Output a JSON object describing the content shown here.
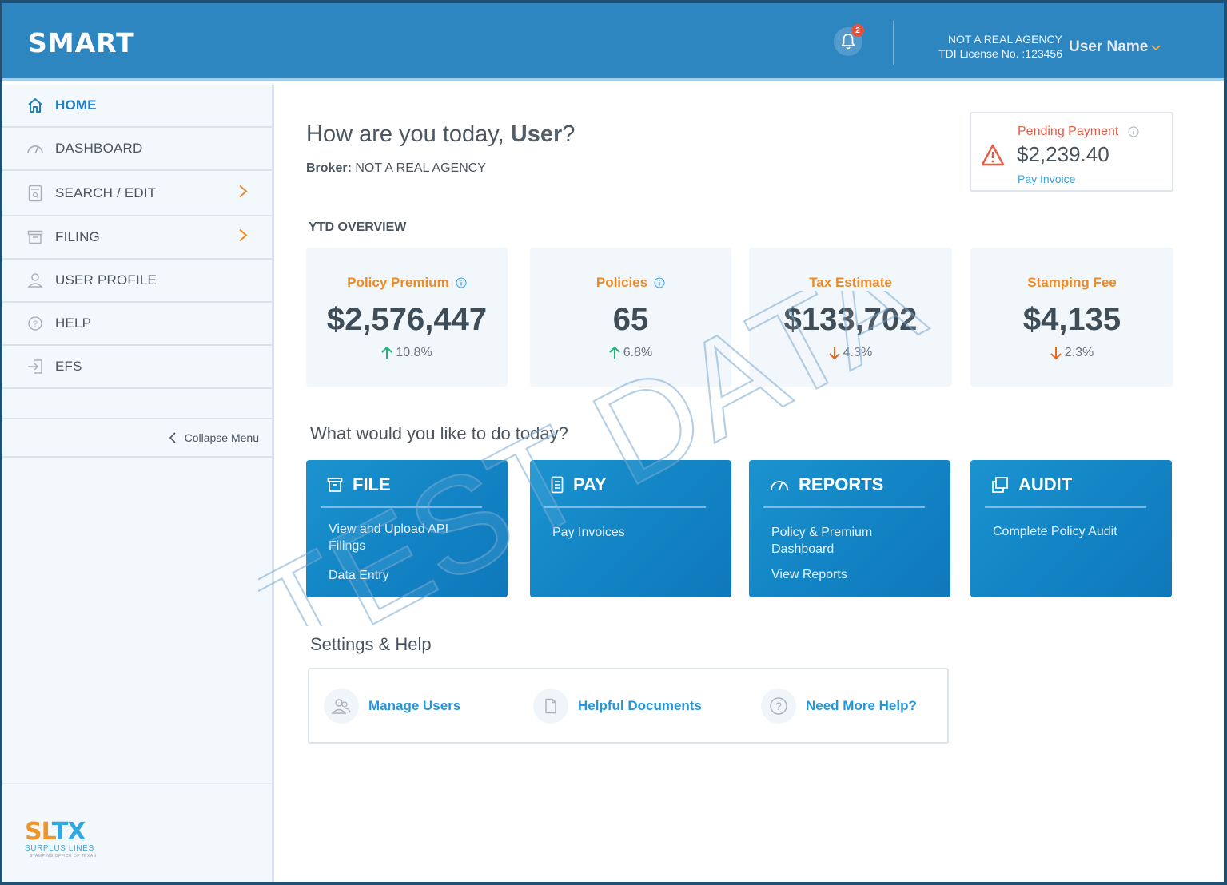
{
  "header": {
    "app_title": "SMART",
    "notification_count": "2",
    "agency_name": "NOT A REAL AGENCY",
    "license": "TDI License No. :123456",
    "user_name": "User Name"
  },
  "sidebar": {
    "items": [
      {
        "label": "HOME",
        "icon": "home-icon",
        "active": true
      },
      {
        "label": "DASHBOARD",
        "icon": "gauge-icon"
      },
      {
        "label": "SEARCH / EDIT",
        "icon": "search-document-icon",
        "has_submenu": true
      },
      {
        "label": "FILING",
        "icon": "archive-box-icon",
        "has_submenu": true
      },
      {
        "label": "USER PROFILE",
        "icon": "user-icon"
      },
      {
        "label": "HELP",
        "icon": "help-circle-icon"
      },
      {
        "label": "EFS",
        "icon": "sign-in-icon"
      }
    ],
    "collapse_label": "Collapse Menu",
    "logo": {
      "main_a": "SL",
      "main_b": "TX",
      "sub": "SURPLUS LINES",
      "tagline": "STAMPING OFFICE OF TEXAS"
    }
  },
  "main": {
    "greeting_prefix": "How are you today,",
    "greeting_name": "User",
    "greeting_suffix": "?",
    "broker_label": "Broker:",
    "broker_value": "NOT A REAL AGENCY",
    "pending": {
      "title": "Pending Payment",
      "amount": "$2,239.40",
      "link": "Pay Invoice"
    },
    "ytd_label": "YTD OVERVIEW",
    "stats": [
      {
        "title": "Policy Premium",
        "value": "$2,576,447",
        "change": "10.8%",
        "direction": "up",
        "info": true
      },
      {
        "title": "Policies",
        "value": "65",
        "change": "6.8%",
        "direction": "up",
        "info": true
      },
      {
        "title": "Tax Estimate",
        "value": "$133,702",
        "change": "4.3%",
        "direction": "down",
        "info": false
      },
      {
        "title": "Stamping Fee",
        "value": "$4,135",
        "change": "2.3%",
        "direction": "down",
        "info": false
      }
    ],
    "actions_label": "What would you like to do today?",
    "actions": [
      {
        "title": "FILE",
        "icon": "archive-box-icon",
        "links": [
          "View and Upload API Filings",
          "Data Entry"
        ]
      },
      {
        "title": "PAY",
        "icon": "invoice-icon",
        "links": [
          "Pay Invoices"
        ]
      },
      {
        "title": "REPORTS",
        "icon": "gauge-icon",
        "links": [
          "Policy & Premium Dashboard",
          "View Reports"
        ]
      },
      {
        "title": "AUDIT",
        "icon": "copy-icon",
        "links": [
          "Complete Policy Audit"
        ]
      }
    ],
    "settings_label": "Settings & Help",
    "settings_links": [
      {
        "label": "Manage Users",
        "icon": "users-icon"
      },
      {
        "label": "Helpful Documents",
        "icon": "document-icon"
      },
      {
        "label": "Need More Help?",
        "icon": "help-circle-icon"
      }
    ],
    "watermark": "TEST DATA"
  },
  "colors": {
    "brand_blue": "#2e86c1",
    "accent_orange": "#eb8a26",
    "alert_red": "#e35b45",
    "up_green": "#1fb57a",
    "down_orange": "#e0692a",
    "link_blue": "#2596d8"
  }
}
